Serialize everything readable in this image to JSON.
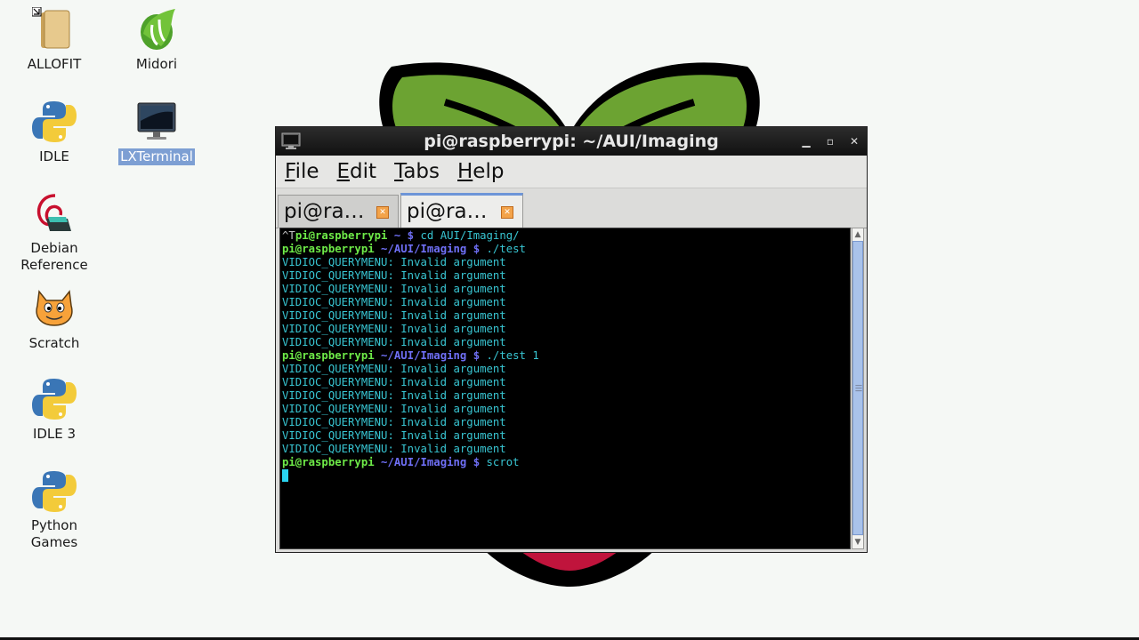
{
  "desktop": {
    "icons": [
      {
        "label": "ALLOFIT",
        "icon": "folder-icon"
      },
      {
        "label": "Midori",
        "icon": "midori-browser-icon"
      },
      {
        "label": "IDLE",
        "icon": "python-icon"
      },
      {
        "label": "LXTerminal",
        "icon": "terminal-monitor-icon",
        "selected": true
      },
      {
        "label": "Debian Reference",
        "icon": "debian-swirl-icon"
      },
      {
        "label": "Scratch",
        "icon": "scratch-cat-icon"
      },
      {
        "label": "IDLE 3",
        "icon": "python-icon"
      },
      {
        "label": "Python Games",
        "icon": "python-icon"
      }
    ]
  },
  "window": {
    "title": "pi@raspberrypi: ~/AUI/Imaging",
    "controls": {
      "minimize": "▁",
      "maximize": "▫",
      "close": "✕"
    },
    "menu": [
      {
        "label": "File",
        "accel": "F",
        "rest": "ile"
      },
      {
        "label": "Edit",
        "accel": "E",
        "rest": "dit"
      },
      {
        "label": "Tabs",
        "accel": "T",
        "rest": "abs"
      },
      {
        "label": "Help",
        "accel": "H",
        "rest": "elp"
      }
    ],
    "tabs": [
      {
        "label": "pi@ra…",
        "active": false
      },
      {
        "label": "pi@ra…",
        "active": true
      }
    ],
    "terminal": {
      "lines": [
        {
          "segments": [
            {
              "t": "^T",
              "c": "c-gray"
            },
            {
              "t": "pi@raspberrypi",
              "c": "c-green"
            },
            {
              "t": " ~ $ ",
              "c": "c-blue"
            },
            {
              "t": "cd AUI/Imaging/",
              "c": "c-cyan"
            }
          ]
        },
        {
          "segments": [
            {
              "t": "pi@raspberrypi",
              "c": "c-green"
            },
            {
              "t": " ~/AUI/Imaging $ ",
              "c": "c-blue"
            },
            {
              "t": "./test",
              "c": "c-cyan"
            }
          ]
        },
        {
          "segments": [
            {
              "t": "VIDIOC_QUERYMENU: Invalid argument",
              "c": "c-cyan"
            }
          ]
        },
        {
          "segments": [
            {
              "t": "VIDIOC_QUERYMENU: Invalid argument",
              "c": "c-cyan"
            }
          ]
        },
        {
          "segments": [
            {
              "t": "VIDIOC_QUERYMENU: Invalid argument",
              "c": "c-cyan"
            }
          ]
        },
        {
          "segments": [
            {
              "t": "VIDIOC_QUERYMENU: Invalid argument",
              "c": "c-cyan"
            }
          ]
        },
        {
          "segments": [
            {
              "t": "VIDIOC_QUERYMENU: Invalid argument",
              "c": "c-cyan"
            }
          ]
        },
        {
          "segments": [
            {
              "t": "VIDIOC_QUERYMENU: Invalid argument",
              "c": "c-cyan"
            }
          ]
        },
        {
          "segments": [
            {
              "t": "VIDIOC_QUERYMENU: Invalid argument",
              "c": "c-cyan"
            }
          ]
        },
        {
          "segments": [
            {
              "t": "pi@raspberrypi",
              "c": "c-green"
            },
            {
              "t": " ~/AUI/Imaging $ ",
              "c": "c-blue"
            },
            {
              "t": "./test 1",
              "c": "c-cyan"
            }
          ]
        },
        {
          "segments": [
            {
              "t": "VIDIOC_QUERYMENU: Invalid argument",
              "c": "c-cyan"
            }
          ]
        },
        {
          "segments": [
            {
              "t": "VIDIOC_QUERYMENU: Invalid argument",
              "c": "c-cyan"
            }
          ]
        },
        {
          "segments": [
            {
              "t": "VIDIOC_QUERYMENU: Invalid argument",
              "c": "c-cyan"
            }
          ]
        },
        {
          "segments": [
            {
              "t": "VIDIOC_QUERYMENU: Invalid argument",
              "c": "c-cyan"
            }
          ]
        },
        {
          "segments": [
            {
              "t": "VIDIOC_QUERYMENU: Invalid argument",
              "c": "c-cyan"
            }
          ]
        },
        {
          "segments": [
            {
              "t": "VIDIOC_QUERYMENU: Invalid argument",
              "c": "c-cyan"
            }
          ]
        },
        {
          "segments": [
            {
              "t": "VIDIOC_QUERYMENU: Invalid argument",
              "c": "c-cyan"
            }
          ]
        },
        {
          "segments": [
            {
              "t": "pi@raspberrypi",
              "c": "c-green"
            },
            {
              "t": " ~/AUI/Imaging $ ",
              "c": "c-blue"
            },
            {
              "t": "scrot",
              "c": "c-cyan"
            }
          ]
        }
      ],
      "colors": {
        "background": "#000000",
        "prompt_user": "#6eea48",
        "prompt_path": "#6f6ff5",
        "output": "#38c5d2",
        "cursor": "#2ad4f0"
      }
    }
  },
  "theme": {
    "desktop_bg": "#f5f8f5",
    "selection": "#7d9fd3",
    "wallpaper_leaf": "#6ca332",
    "wallpaper_berry": "#c0143c"
  }
}
